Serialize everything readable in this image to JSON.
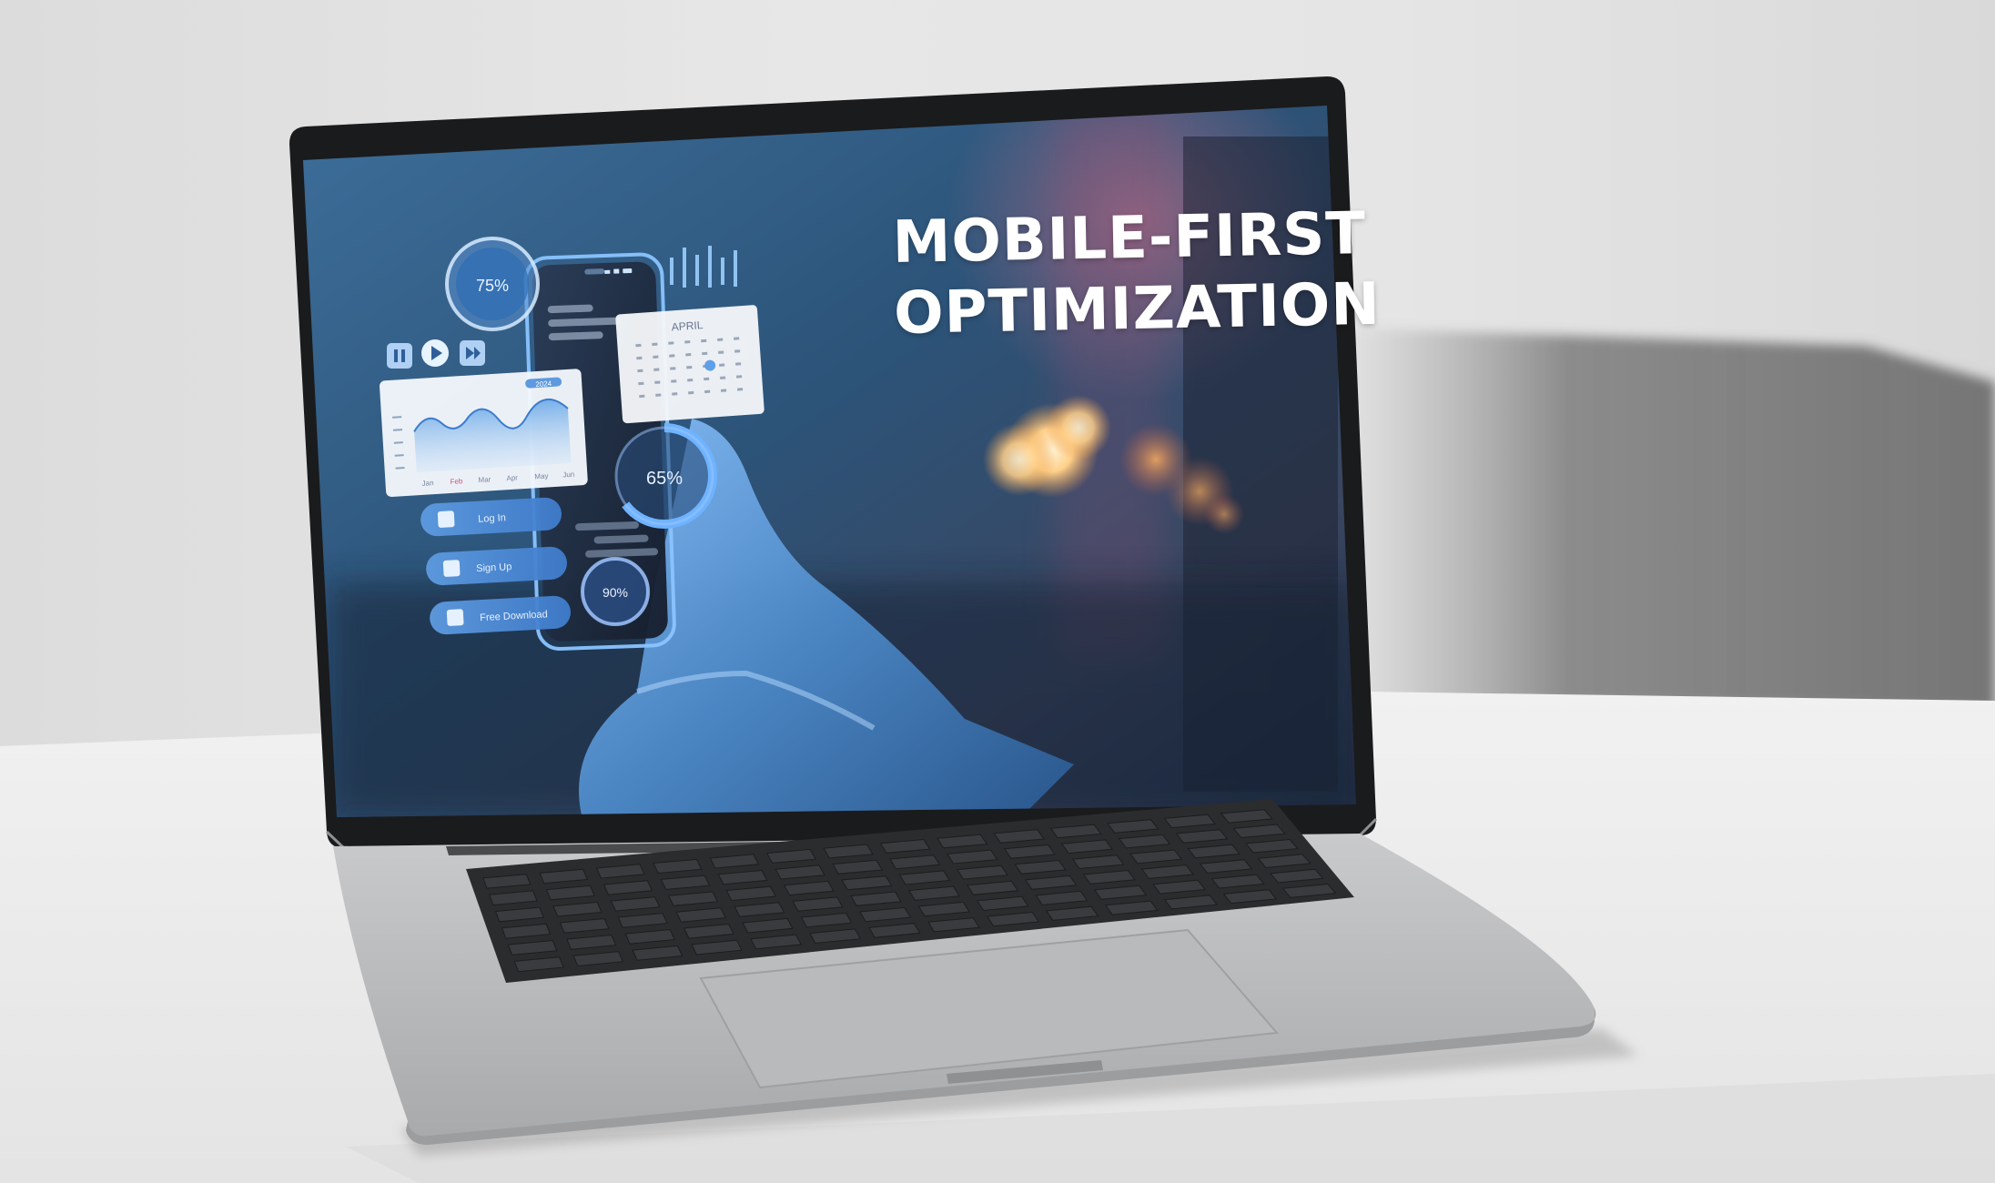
{
  "headline": {
    "line1": "MOBILE-FIRST",
    "line2": "OPTIMIZATION"
  },
  "overlay": {
    "gauge_top": "75%",
    "gauge_mid": "65%",
    "gauge_bottom": "90%",
    "calendar_month": "APRIL",
    "chart_months": [
      "Jan",
      "Feb",
      "Mar",
      "Apr",
      "May",
      "Jun"
    ],
    "chart_badge": "2024",
    "buttons": [
      "Log In",
      "Sign Up",
      "Free Download"
    ]
  },
  "icons": [
    "pause-icon",
    "play-icon",
    "next-icon",
    "signal-icon",
    "wifi-icon",
    "battery-icon"
  ],
  "colors": {
    "background": "#e3e3e3",
    "laptop_body": "#bfc0c2",
    "screen_blue": "#2f5f87",
    "accent_glow": "#7fb7ff",
    "bokeh": "#ffd59a",
    "headline": "#ffffff"
  }
}
